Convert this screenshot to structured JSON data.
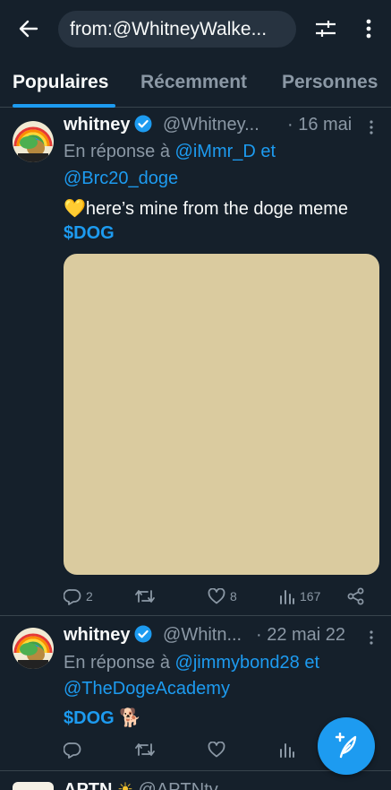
{
  "search": {
    "query": "from:@WhitneyWalke..."
  },
  "tabs": [
    {
      "label": "Populaires"
    },
    {
      "label": "Récemment"
    },
    {
      "label": "Personnes"
    }
  ],
  "tweets": [
    {
      "name": "whitney",
      "handle": "@Whitney...",
      "date": "· 16 mai",
      "reply_prefix": "En réponse à",
      "reply_user1": "@iMmr_D",
      "reply_and": "et",
      "reply_user2": "@Brc20_doge",
      "text_emoji": "💛",
      "text": "here’s mine from the doge meme",
      "cashtag": "$DOG",
      "replies": "2",
      "retweets": "",
      "likes": "8",
      "views": "167",
      "media_color": "#dacb9f"
    },
    {
      "name": "whitney",
      "handle": "@Whitn...",
      "date": "· 22 mai 22",
      "reply_prefix": "En réponse à",
      "reply_user1": "@jimmybond28",
      "reply_and": "et",
      "reply_user2": "@TheDogeAcademy",
      "cashtag": "$DOG",
      "text_emoji": "🐕",
      "replies": "",
      "retweets": "",
      "likes": "",
      "views": ""
    },
    {
      "name": "APTN",
      "handle": "@APTNtv"
    }
  ],
  "colors": {
    "background": "#15202b",
    "accent": "#1d9bf0",
    "muted": "#8b98a5",
    "divider": "#38444d"
  }
}
